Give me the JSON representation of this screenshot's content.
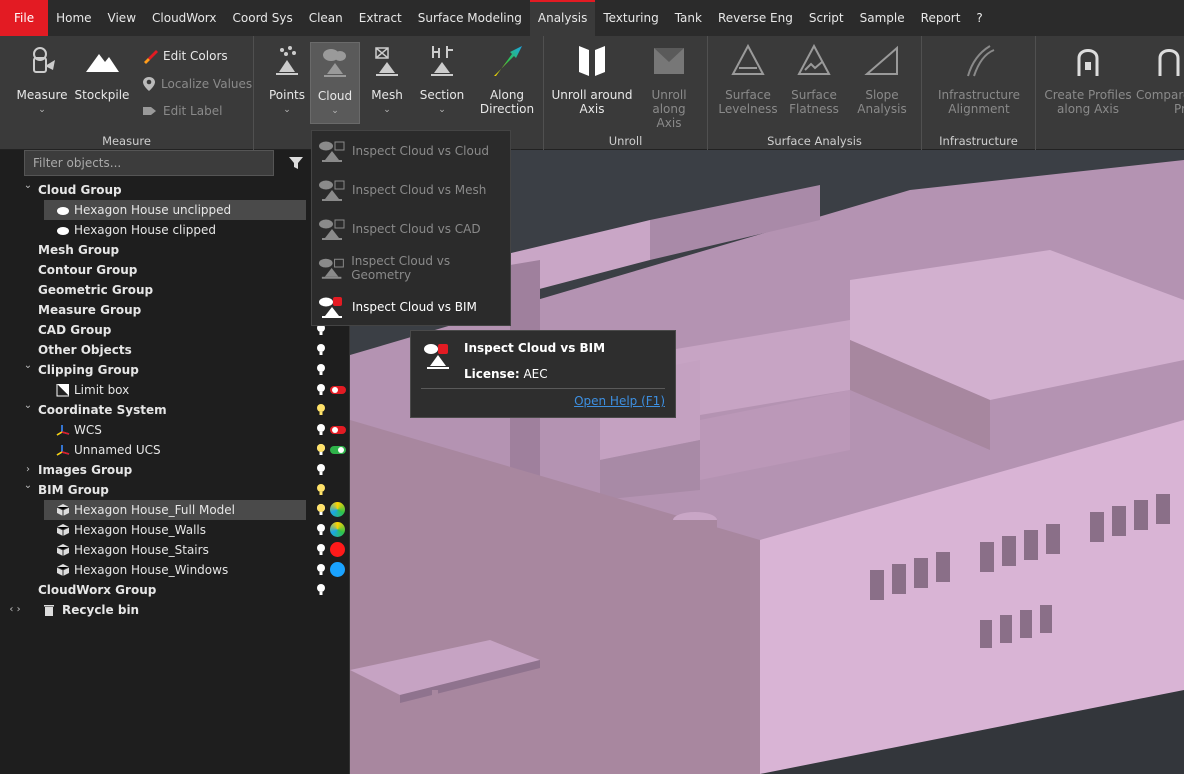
{
  "menu": {
    "tabs": [
      "File",
      "Home",
      "View",
      "CloudWorx",
      "Coord Sys",
      "Clean",
      "Extract",
      "Surface Modeling",
      "Analysis",
      "Texturing",
      "Tank",
      "Reverse Eng",
      "Script",
      "Sample",
      "Report",
      "?"
    ],
    "active": "Analysis"
  },
  "ribbon": {
    "measure_group": {
      "label": "Measure",
      "measure": "Measure",
      "stockpile": "Stockpile",
      "edit_colors": "Edit Colors",
      "localize_values": "Localize Values",
      "edit_label": "Edit Label"
    },
    "inspect_group": {
      "points": "Points",
      "cloud": "Cloud",
      "mesh": "Mesh",
      "section": "Section",
      "along_direction_1": "Along",
      "along_direction_2": "Direction"
    },
    "unroll_group": {
      "label": "Unroll",
      "unroll_around_axis_1": "Unroll around",
      "unroll_around_axis_2": "Axis",
      "unroll_along_axis_1": "Unroll along",
      "unroll_along_axis_2": "Axis"
    },
    "surface_group": {
      "label": "Surface Analysis",
      "levelness_1": "Surface",
      "levelness_2": "Levelness",
      "flatness_1": "Surface",
      "flatness_2": "Flatness",
      "slope_1": "Slope",
      "slope_2": "Analysis"
    },
    "infra_group": {
      "label": "Infrastructure",
      "alignment_1": "Infrastructure",
      "alignment_2": "Alignment"
    },
    "profiles_group": {
      "create_profiles_1": "Create Profiles",
      "create_profiles_2": "along Axis",
      "compare_1": "Compare",
      "compare_2": "Prof"
    }
  },
  "filter": {
    "placeholder": "Filter objects..."
  },
  "tree": [
    {
      "label": "Cloud Group",
      "bold": true,
      "arrow": "down",
      "indent": 0
    },
    {
      "label": "Hexagon House unclipped",
      "bold": false,
      "indent": 2,
      "icon": "cloud-icon",
      "selected": true
    },
    {
      "label": "Hexagon House clipped",
      "bold": false,
      "indent": 2,
      "icon": "cloud-icon"
    },
    {
      "label": "Mesh Group",
      "bold": true,
      "indent": 1
    },
    {
      "label": "Contour Group",
      "bold": true,
      "indent": 1
    },
    {
      "label": "Geometric Group",
      "bold": true,
      "indent": 1
    },
    {
      "label": "Measure Group",
      "bold": true,
      "indent": 1
    },
    {
      "label": "CAD Group",
      "bold": true,
      "indent": 1,
      "bulb": "white"
    },
    {
      "label": "Other Objects",
      "bold": true,
      "indent": 1,
      "bulb": "white"
    },
    {
      "label": "Clipping Group",
      "bold": true,
      "arrow": "down",
      "indent": 0,
      "bulb": "white"
    },
    {
      "label": "Limit box",
      "bold": false,
      "indent": 2,
      "icon": "limit-box-icon",
      "bulb": "white",
      "toggle": "red"
    },
    {
      "label": "Coordinate System",
      "bold": true,
      "arrow": "down",
      "indent": 0,
      "bulb": "yellow"
    },
    {
      "label": "WCS",
      "bold": false,
      "indent": 2,
      "icon": "axis-icon",
      "bulb": "white",
      "toggle": "red"
    },
    {
      "label": "Unnamed UCS",
      "bold": false,
      "indent": 2,
      "icon": "axis-icon",
      "bulb": "lit",
      "toggle": "green"
    },
    {
      "label": "Images Group",
      "bold": true,
      "arrow": "right",
      "indent": 0,
      "bulb": "white"
    },
    {
      "label": "BIM Group",
      "bold": true,
      "arrow": "down",
      "indent": 0,
      "bulb": "yellow"
    },
    {
      "label": "Hexagon House_Full Model",
      "bold": false,
      "indent": 2,
      "icon": "bim-icon",
      "selected": true,
      "bulb": "lit",
      "dot": "multi"
    },
    {
      "label": "Hexagon House_Walls",
      "bold": false,
      "indent": 2,
      "icon": "bim-icon",
      "bulb": "white",
      "dot": "multi"
    },
    {
      "label": "Hexagon House_Stairs",
      "bold": false,
      "indent": 2,
      "icon": "bim-icon",
      "bulb": "white",
      "dot": "red"
    },
    {
      "label": "Hexagon House_Windows",
      "bold": false,
      "indent": 2,
      "icon": "bim-icon",
      "bulb": "white",
      "dot": "blue"
    },
    {
      "label": "CloudWorx Group",
      "bold": true,
      "indent": 1,
      "bulb": "white"
    },
    {
      "label": "Recycle bin",
      "bold": true,
      "arrow": "both",
      "indent": 1,
      "icon": "trash-icon"
    }
  ],
  "dropdown": {
    "items": [
      {
        "label": "Inspect Cloud vs Cloud",
        "enabled": false
      },
      {
        "label": "Inspect Cloud vs Mesh",
        "enabled": false
      },
      {
        "label": "Inspect Cloud vs CAD",
        "enabled": false
      },
      {
        "label": "Inspect Cloud vs Geometry",
        "enabled": false
      },
      {
        "label": "Inspect Cloud vs BIM",
        "enabled": true
      }
    ]
  },
  "tooltip": {
    "title": "Inspect Cloud vs BIM",
    "license_label": "License:",
    "license_value": "AEC",
    "help_link": "Open Help (F1)"
  },
  "colors": {
    "accent": "#e31b23",
    "building": "#c9a0c4",
    "link": "#3d8fe0"
  }
}
